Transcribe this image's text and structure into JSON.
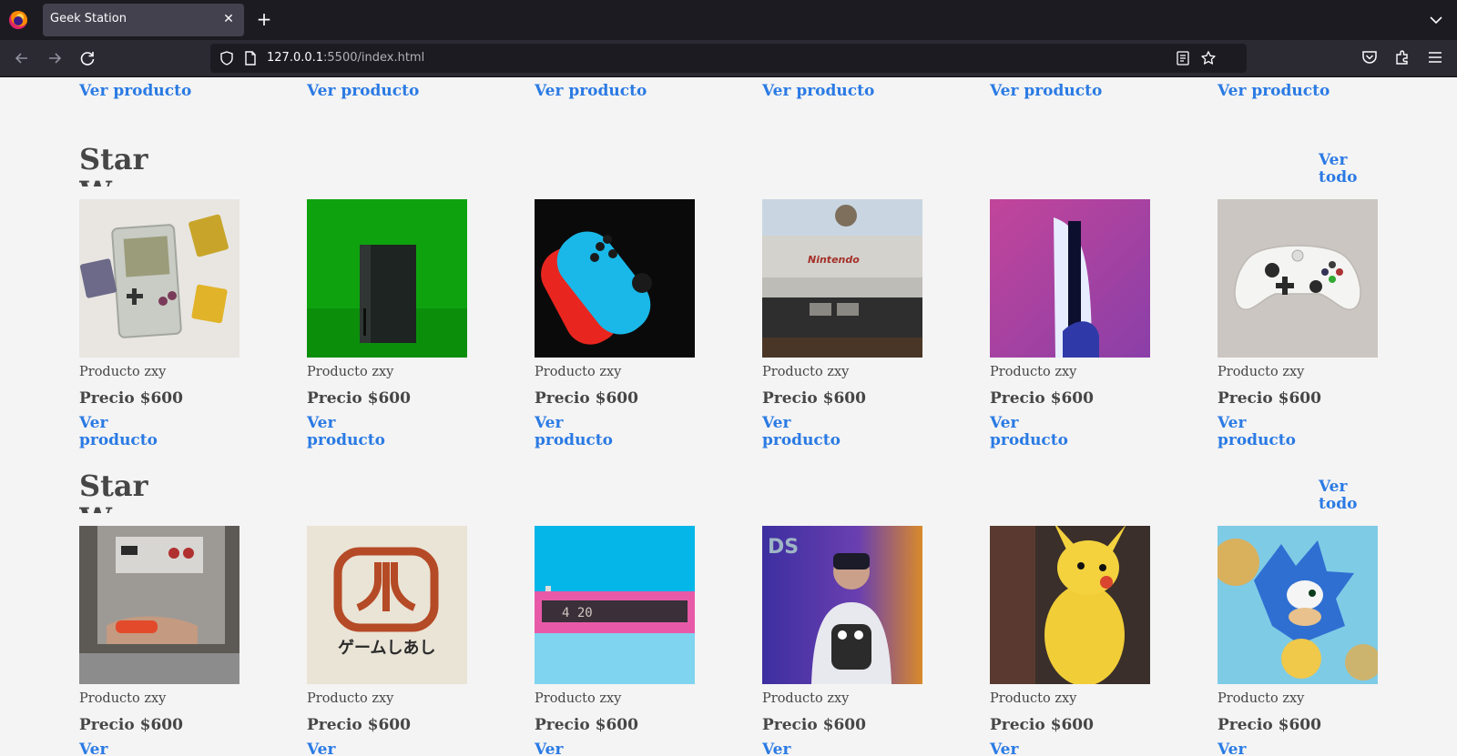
{
  "browser": {
    "tab_title": "Geek Station",
    "url_host": "127.0.0.1",
    "url_rest": ":5500/index.html"
  },
  "colors": {
    "accent": "#2a7ae4",
    "text": "#464646",
    "background": "#f4f4f4"
  },
  "top_row_links": [
    "Ver producto",
    "Ver producto",
    "Ver producto",
    "Ver producto",
    "Ver producto",
    "Ver producto"
  ],
  "sections": [
    {
      "title": "Star Wars",
      "see_all": "Ver todo",
      "products": [
        {
          "image": "game-boy",
          "name": "Producto zxy",
          "price": "Precio $600",
          "link": "Ver producto"
        },
        {
          "image": "xbox-series-x",
          "name": "Producto zxy",
          "price": "Precio $600",
          "link": "Ver producto"
        },
        {
          "image": "switch-joycons",
          "name": "Producto zxy",
          "price": "Precio $600",
          "link": "Ver producto"
        },
        {
          "image": "nes-console",
          "name": "Producto zxy",
          "price": "Precio $600",
          "link": "Ver producto"
        },
        {
          "image": "ps5-console",
          "name": "Producto zxy",
          "price": "Precio $600",
          "link": "Ver producto"
        },
        {
          "image": "xbox-controller",
          "name": "Producto zxy",
          "price": "Precio $600",
          "link": "Ver producto"
        }
      ]
    },
    {
      "title": "Star Wars",
      "see_all": "Ver todo",
      "products": [
        {
          "image": "nes-tshirt-kid",
          "name": "Producto zxy",
          "price": "Precio $600",
          "link": "Ver producto"
        },
        {
          "image": "atari-tshirt",
          "name": "Producto zxy",
          "price": "Precio $600",
          "link": "Ver producto"
        },
        {
          "image": "pink-clock",
          "name": "Producto zxy",
          "price": "Precio $600",
          "link": "Ver producto"
        },
        {
          "image": "vr-headset-boy",
          "name": "Producto zxy",
          "price": "Precio $600",
          "link": "Ver producto"
        },
        {
          "image": "pikachu-figure",
          "name": "Producto zxy",
          "price": "Precio $600",
          "link": "Ver producto"
        },
        {
          "image": "sonic-figure",
          "name": "Producto zxy",
          "price": "Precio $600",
          "link": "Ver producto"
        }
      ]
    }
  ]
}
